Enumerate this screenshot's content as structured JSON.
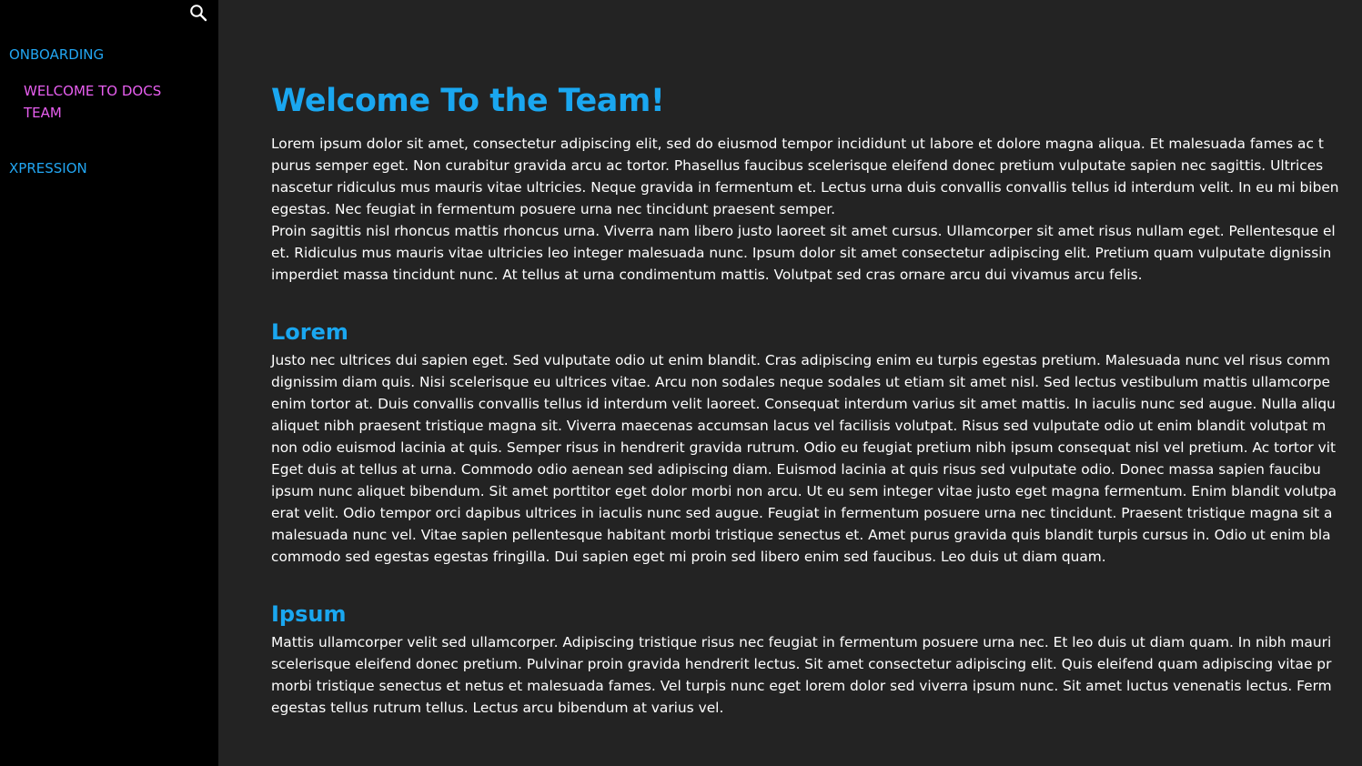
{
  "sidebar": {
    "search_icon": "search-icon",
    "nav": [
      {
        "label": "ONBOARDING",
        "children": [
          {
            "label": "WELCOME TO DOCS TEAM"
          }
        ]
      },
      {
        "label": "XPRESSION",
        "children": []
      }
    ]
  },
  "colors": {
    "accent_blue": "#1aa7f0",
    "accent_pink": "#e85ff0",
    "sidebar_bg": "#000000",
    "main_bg": "#232323"
  },
  "main": {
    "title": "Welcome To the Team!",
    "intro": "Lorem ipsum dolor sit amet, consectetur adipiscing elit, sed do eiusmod tempor incididunt ut labore et dolore magna aliqua. Et malesuada fames ac t\npurus semper eget. Non curabitur gravida arcu ac tortor. Phasellus faucibus scelerisque eleifend donec pretium vulputate sapien nec sagittis. Ultrices\nnascetur ridiculus mus mauris vitae ultricies. Neque gravida in fermentum et. Lectus urna duis convallis convallis tellus id interdum velit. In eu mi biben\negestas. Nec feugiat in fermentum posuere urna nec tincidunt praesent semper.\nProin sagittis nisl rhoncus mattis rhoncus urna. Viverra nam libero justo laoreet sit amet cursus. Ullamcorper sit amet risus nullam eget. Pellentesque el\net. Ridiculus mus mauris vitae ultricies leo integer malesuada nunc. Ipsum dolor sit amet consectetur adipiscing elit. Pretium quam vulputate dignissin\nimperdiet massa tincidunt nunc. At tellus at urna condimentum mattis. Volutpat sed cras ornare arcu dui vivamus arcu felis.",
    "sections": [
      {
        "heading": "Lorem",
        "body": "Justo nec ultrices dui sapien eget. Sed vulputate odio ut enim blandit. Cras adipiscing enim eu turpis egestas pretium. Malesuada nunc vel risus comm\ndignissim diam quis. Nisi scelerisque eu ultrices vitae. Arcu non sodales neque sodales ut etiam sit amet nisl. Sed lectus vestibulum mattis ullamcorpe\nenim tortor at. Duis convallis convallis tellus id interdum velit laoreet. Consequat interdum varius sit amet mattis. In iaculis nunc sed augue. Nulla aliqu\naliquet nibh praesent tristique magna sit. Viverra maecenas accumsan lacus vel facilisis volutpat. Risus sed vulputate odio ut enim blandit volutpat m\nnon odio euismod lacinia at quis. Semper risus in hendrerit gravida rutrum. Odio eu feugiat pretium nibh ipsum consequat nisl vel pretium. Ac tortor vit\nEget duis at tellus at urna. Commodo odio aenean sed adipiscing diam. Euismod lacinia at quis risus sed vulputate odio. Donec massa sapien faucibu\nipsum nunc aliquet bibendum. Sit amet porttitor eget dolor morbi non arcu. Ut eu sem integer vitae justo eget magna fermentum. Enim blandit volutpa\nerat velit. Odio tempor orci dapibus ultrices in iaculis nunc sed augue. Feugiat in fermentum posuere urna nec tincidunt. Praesent tristique magna sit a\nmalesuada nunc vel. Vitae sapien pellentesque habitant morbi tristique senectus et. Amet purus gravida quis blandit turpis cursus in. Odio ut enim bla\ncommodo sed egestas egestas fringilla. Dui sapien eget mi proin sed libero enim sed faucibus. Leo duis ut diam quam."
      },
      {
        "heading": "Ipsum",
        "body": "Mattis ullamcorper velit sed ullamcorper. Adipiscing tristique risus nec feugiat in fermentum posuere urna nec. Et leo duis ut diam quam. In nibh mauri\nscelerisque eleifend donec pretium. Pulvinar proin gravida hendrerit lectus. Sit amet consectetur adipiscing elit. Quis eleifend quam adipiscing vitae pr\nmorbi tristique senectus et netus et malesuada fames. Vel turpis nunc eget lorem dolor sed viverra ipsum nunc. Sit amet luctus venenatis lectus. Ferm\negestas tellus rutrum tellus. Lectus arcu bibendum at varius vel."
      }
    ]
  }
}
